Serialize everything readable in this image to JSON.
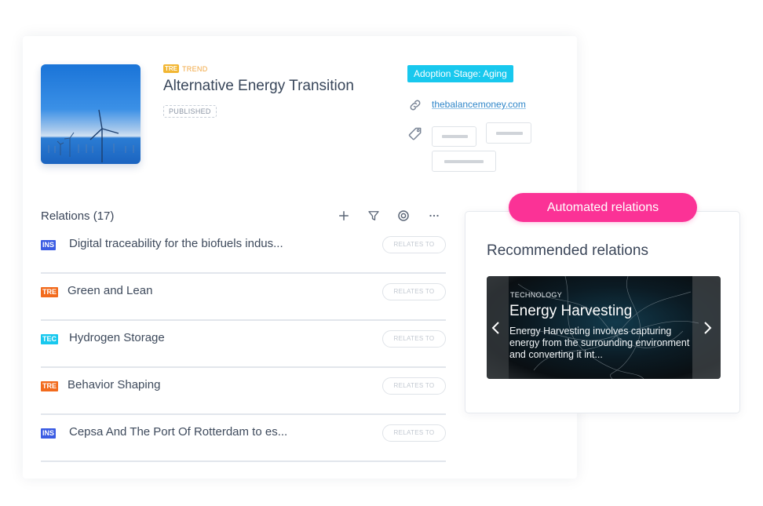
{
  "trend": {
    "type_badge": "TRE",
    "type_label": "TREND",
    "title": "Alternative Energy Transition",
    "status": "PUBLISHED",
    "image_icon": "wind-turbines-image",
    "adoption_stage": "Adoption Stage: Aging",
    "link": "thebalancemoney.com",
    "link_icon": "link-icon",
    "tag_icon": "tag-icon",
    "tags": [
      "",
      "",
      ""
    ]
  },
  "relations": {
    "title": "Relations (17)",
    "tools": [
      {
        "name": "add",
        "icon": "plus-icon"
      },
      {
        "name": "filter",
        "icon": "filter-icon"
      },
      {
        "name": "focus",
        "icon": "target-icon"
      },
      {
        "name": "more",
        "icon": "more-icon"
      }
    ],
    "items": [
      {
        "type": "INS",
        "color": "#3b5ce3",
        "name": "Digital traceability for the biofuels indus...",
        "action": "RELATES TO"
      },
      {
        "type": "TRE",
        "color": "#f26b1d",
        "name": "Green and Lean",
        "action": "RELATES TO"
      },
      {
        "type": "TEC",
        "color": "#18c8ee",
        "name": "Hydrogen Storage",
        "action": "RELATES TO"
      },
      {
        "type": "TRE",
        "color": "#f26b1d",
        "name": "Behavior Shaping",
        "action": "RELATES TO"
      },
      {
        "type": "INS",
        "color": "#3b5ce3",
        "name": "Cepsa And The Port Of Rotterdam to es...",
        "action": "RELATES TO"
      }
    ]
  },
  "recommended": {
    "pill_label": "Automated relations",
    "title": "Recommended relations",
    "card": {
      "category": "TECHNOLOGY",
      "title": "Energy Harvesting",
      "description": "Energy Harvesting involves capturing energy from the surrounding environment and converting it int..."
    },
    "prev_icon": "chevron-left-icon",
    "next_icon": "chevron-right-icon"
  },
  "colors": {
    "accent_pink": "#fb3296",
    "stage_cyan": "#18c8ee",
    "trend_yellow": "#f2b632",
    "link_blue": "#2f86c9"
  }
}
